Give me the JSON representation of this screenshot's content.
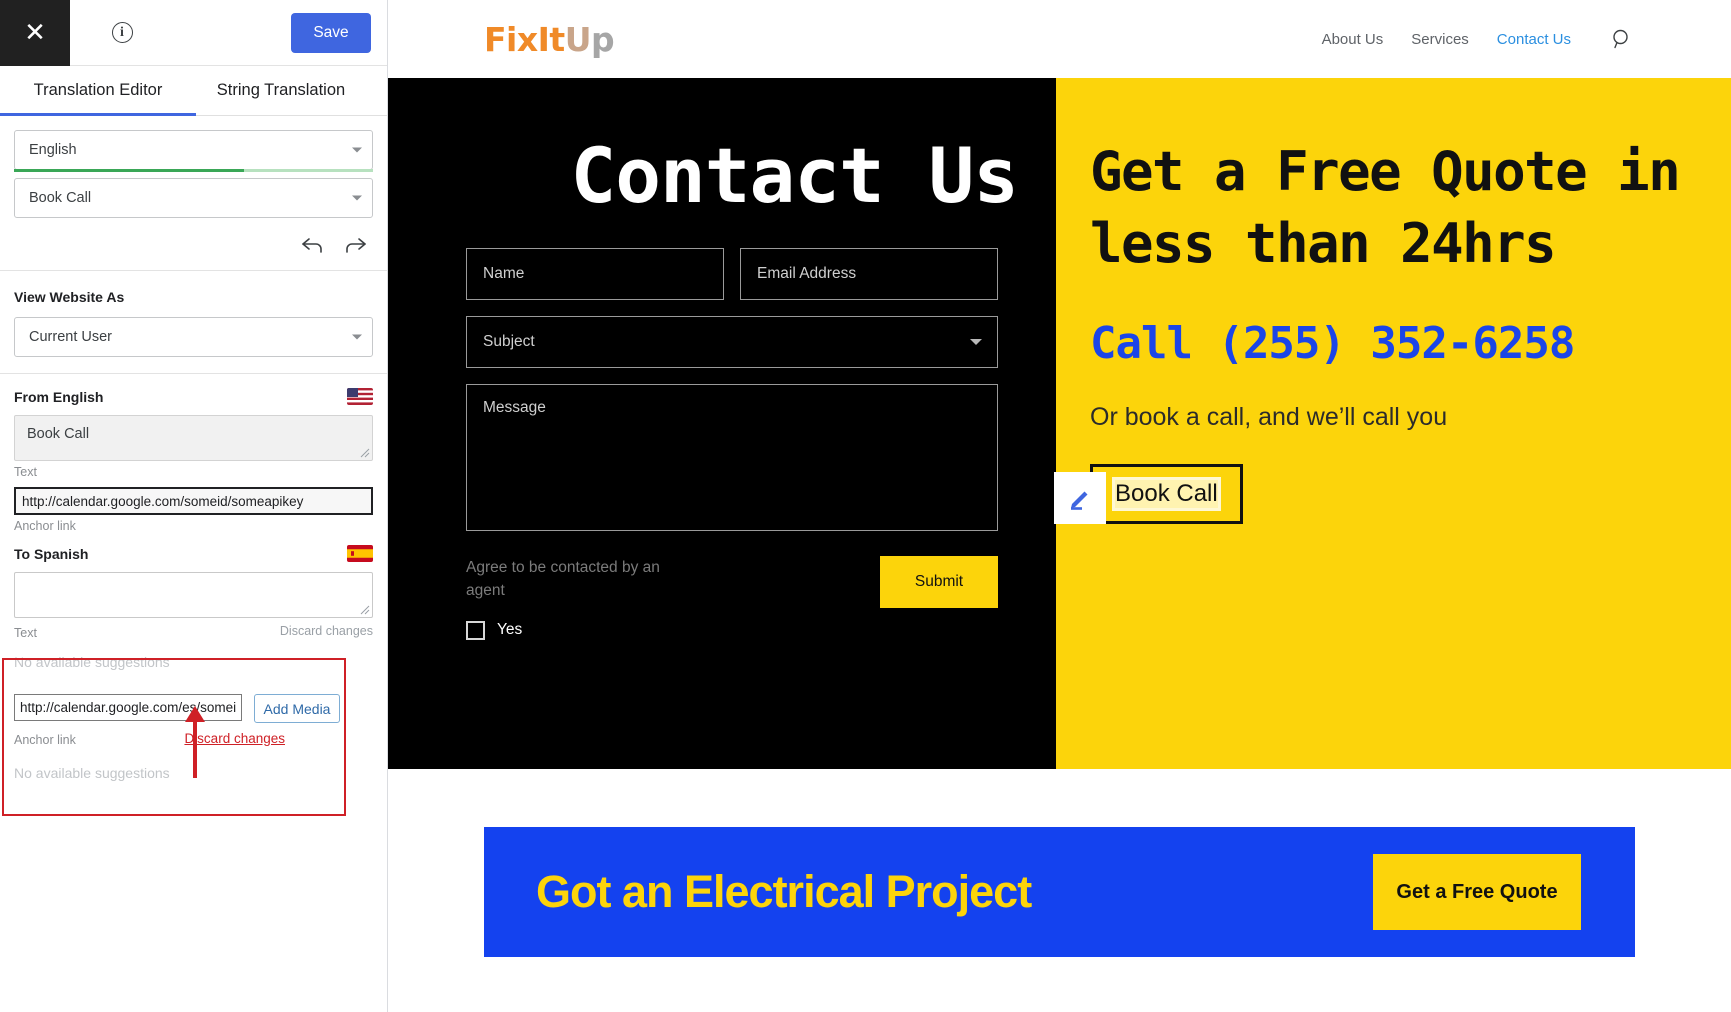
{
  "sidebar": {
    "topbar": {
      "close_label": "✕",
      "info_label": "i",
      "save_label": "Save"
    },
    "tabs": [
      {
        "label": "Translation Editor",
        "active": true
      },
      {
        "label": "String Translation",
        "active": false
      }
    ],
    "language_select": {
      "value": "English",
      "progress_percent": 64
    },
    "string_select": {
      "value": "Book Call"
    },
    "history": {
      "undo_label": "undo-arrow",
      "redo_label": "redo-arrow"
    },
    "view_website_as": {
      "heading": "View Website As",
      "select_value": "Current User"
    },
    "from": {
      "heading": "From English",
      "flag": "us-flag",
      "text_value": "Book Call",
      "text_sublabel": "Text",
      "anchor_value": "http://calendar.google.com/someid/someapikey",
      "anchor_sublabel": "Anchor link"
    },
    "to": {
      "heading": "To Spanish",
      "flag": "es-flag",
      "text_value": "",
      "text_sublabel": "Text",
      "discard_label": "Discard changes",
      "no_suggestions": "No available suggestions"
    },
    "annotated": {
      "anchor_value": "http://calendar.google.com/es/someid",
      "anchor_sublabel": "Anchor link",
      "add_media_label": "Add Media",
      "callout_label": "Discard changes",
      "no_suggestions": "No available suggestions",
      "highlight_color": "#cf2026"
    }
  },
  "site": {
    "logo": {
      "part1": "FixIt",
      "part2": "U",
      "part3": "p"
    },
    "nav": [
      {
        "label": "About Us",
        "active": false
      },
      {
        "label": "Services",
        "active": false
      },
      {
        "label": "Contact Us",
        "active": true
      }
    ],
    "search_icon": "search-icon",
    "hero": {
      "title": "Contact Us",
      "form": {
        "name_placeholder": "Name",
        "email_placeholder": "Email Address",
        "subject_placeholder": "Subject",
        "message_placeholder": "Message",
        "agree_text": "Agree to be contacted by an agent",
        "yes_label": "Yes",
        "submit_label": "Submit"
      },
      "promo": {
        "headline": "Get a Free Quote in less than 24hrs",
        "phone": "Call (255) 352-6258",
        "subtext": "Or book a call, and we’ll call you",
        "book_label": "Book Call",
        "edit_icon": "pencil-icon",
        "accent_yellow": "#FCD40B",
        "accent_blue": "#1B45E8"
      }
    },
    "cta": {
      "headline": "Got an Electrical Project",
      "button_label": "Get a Free Quote",
      "background": "#1442EF"
    }
  }
}
